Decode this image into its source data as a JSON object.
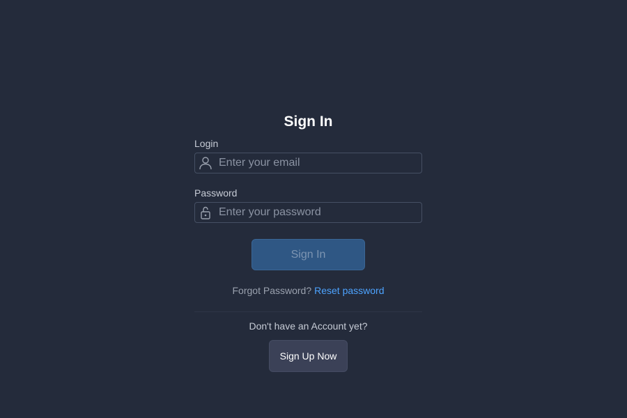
{
  "form": {
    "title": "Sign In",
    "login": {
      "label": "Login",
      "placeholder": "Enter your email",
      "value": "",
      "icon": "user-icon"
    },
    "password": {
      "label": "Password",
      "placeholder": "Enter your password",
      "value": "",
      "icon": "lock-icon"
    },
    "submit_label": "Sign In",
    "forgot_text": "Forgot Password?",
    "reset_link": "Reset password",
    "no_account_text": "Don't have an Account yet?",
    "signup_label": "Sign Up Now"
  },
  "colors": {
    "background": "#242b3b",
    "primary_button": "#2f5784",
    "link": "#4da3ff",
    "secondary_button": "#3b4157"
  }
}
